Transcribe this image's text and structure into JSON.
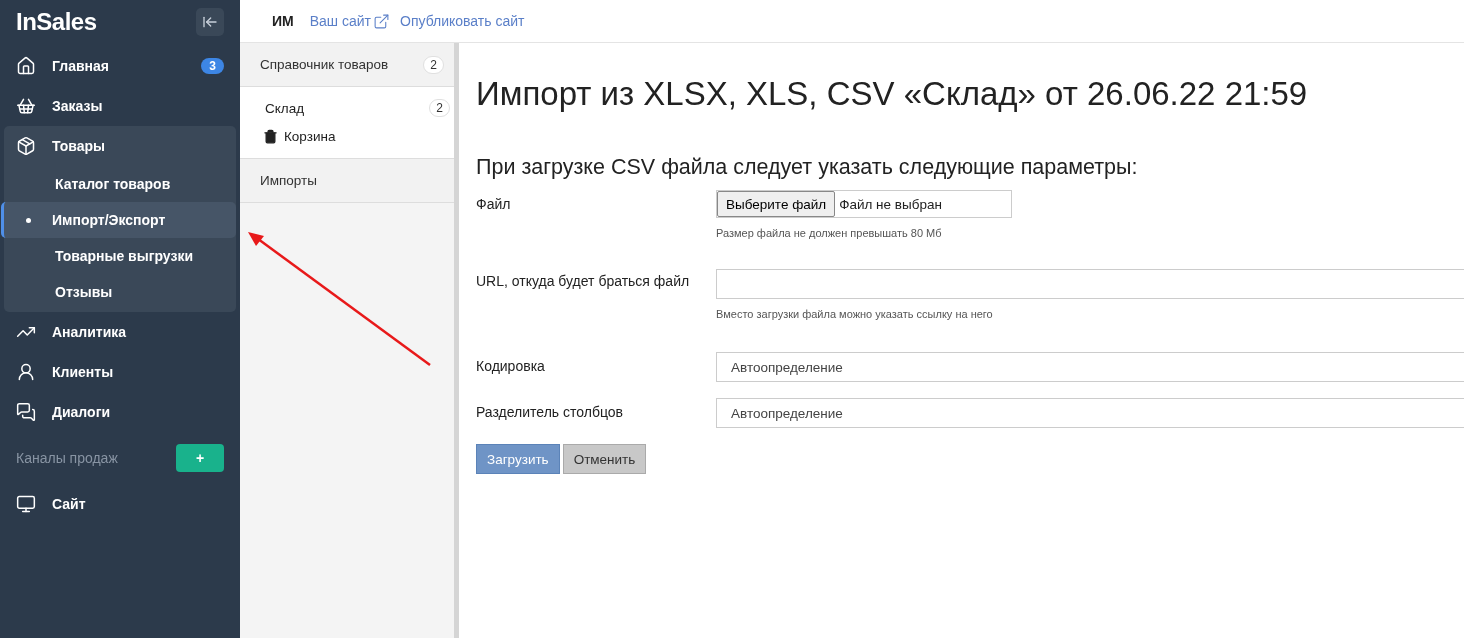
{
  "sidebar": {
    "logo": "InSales",
    "items": [
      {
        "label": "Главная",
        "kind": "home",
        "badge": "3",
        "selected": false,
        "expanded": false
      },
      {
        "label": "Заказы",
        "kind": "basket",
        "selected": false,
        "expanded": false
      },
      {
        "label": "Товары",
        "kind": "box",
        "selected": false,
        "expanded": true,
        "children": [
          {
            "label": "Каталог товаров",
            "selected": false
          },
          {
            "label": "Импорт/Экспорт",
            "selected": true
          },
          {
            "label": "Товарные выгрузки",
            "selected": false
          },
          {
            "label": "Отзывы",
            "selected": false
          }
        ]
      },
      {
        "label": "Аналитика",
        "kind": "chart",
        "selected": false,
        "expanded": false
      },
      {
        "label": "Клиенты",
        "kind": "clients",
        "selected": false,
        "expanded": false
      },
      {
        "label": "Диалоги",
        "kind": "chat",
        "selected": false,
        "expanded": false
      }
    ],
    "channels_heading": "Каналы продаж",
    "add_button": "+",
    "channels": [
      {
        "label": "Сайт",
        "kind": "monitor",
        "selected": false
      }
    ]
  },
  "topbar": {
    "shop": "ИМ",
    "links": [
      {
        "label": "Ваш сайт",
        "external": true
      },
      {
        "label": "Опубликовать сайт",
        "external": false
      }
    ]
  },
  "subnav": [
    {
      "kind": "header",
      "label": "Справочник товаров",
      "count": "2"
    },
    {
      "kind": "item",
      "label": "Склад",
      "count": "2"
    },
    {
      "kind": "trash",
      "label": "Корзина"
    },
    {
      "kind": "header",
      "label": "Импорты"
    }
  ],
  "page": {
    "title": "Импорт из XLSX, XLS, CSV «Склад» от 26.06.22 21:59",
    "subtitle": "При загрузке CSV файла следует указать следующие параметры:",
    "fields": [
      {
        "kind": "file",
        "label": "Файл",
        "button": "Выберите файл",
        "value": "Файл не выбран",
        "hint": "Размер файла не должен превышать 80 Мб"
      },
      {
        "kind": "text",
        "label": "URL, откуда будет браться файл",
        "hint": "Вместо загрузки файла можно указать ссылку на него"
      },
      {
        "kind": "select",
        "label": "Кодировка",
        "value": "Автоопределение"
      },
      {
        "kind": "select",
        "label": "Разделитель столбцов",
        "value": "Автоопределение"
      }
    ],
    "buttons": [
      {
        "label": "Загрузить",
        "kind": "primary"
      },
      {
        "label": "Отменить",
        "kind": "secondary"
      }
    ]
  }
}
